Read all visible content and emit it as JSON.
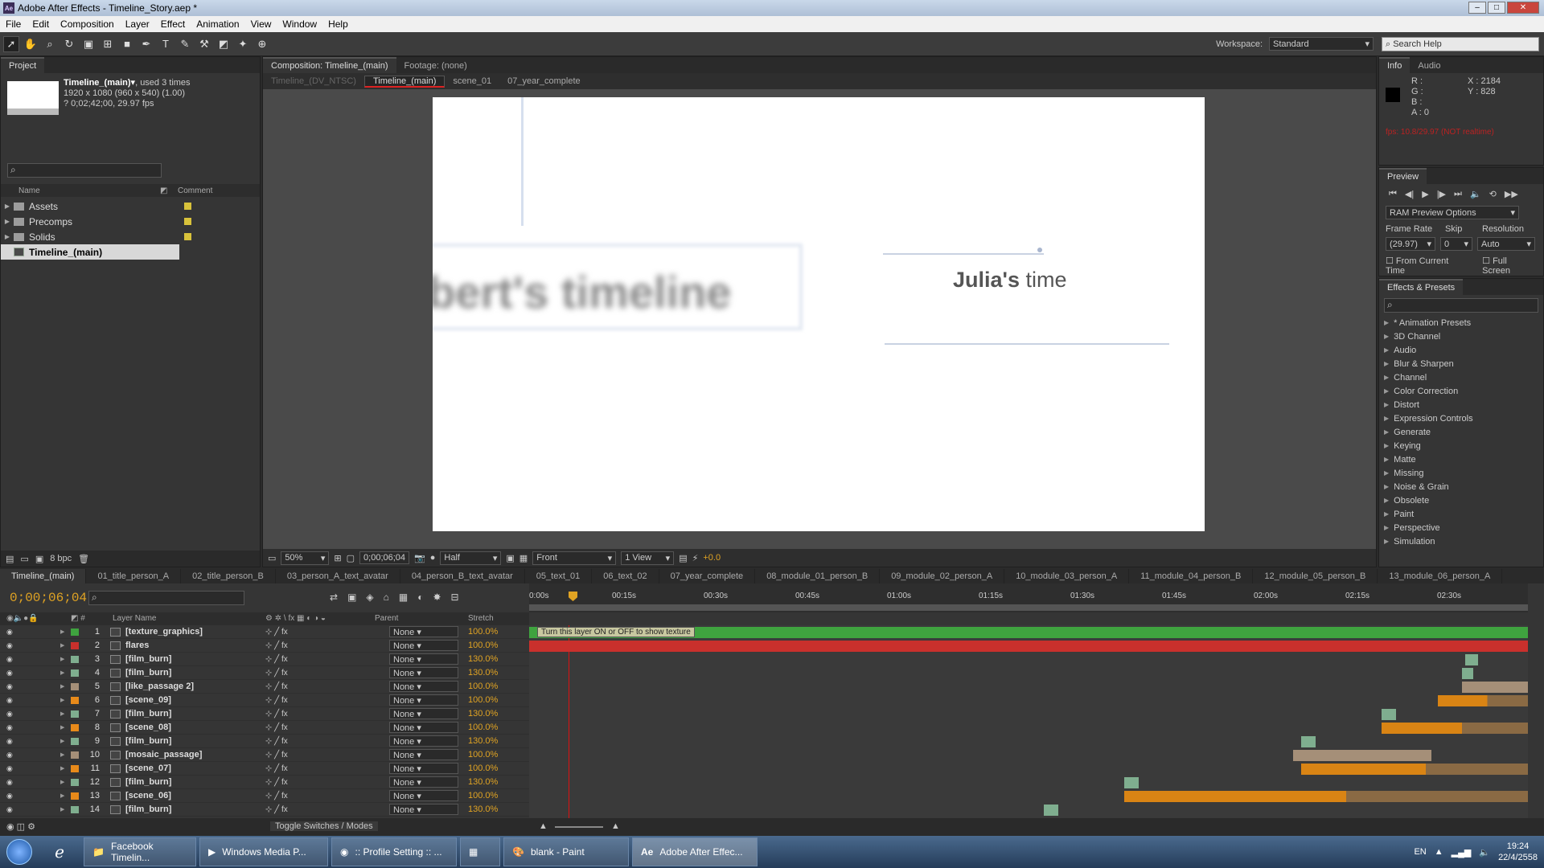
{
  "window": {
    "title": "Adobe After Effects - Timeline_Story.aep *"
  },
  "menu": [
    "File",
    "Edit",
    "Composition",
    "Layer",
    "Effect",
    "Animation",
    "View",
    "Window",
    "Help"
  ],
  "toolbar": {
    "workspace_label": "Workspace:",
    "workspace_value": "Standard",
    "search_placeholder": "Search Help"
  },
  "project": {
    "tab": "Project",
    "item_name": "Timeline_(main)▾",
    "item_used": ", used 3 times",
    "item_size": "1920 x 1080  (960 x 540) (1.00)",
    "item_duration": "? 0;02;42;00, 29.97 fps",
    "col_name": "Name",
    "col_comment": "Comment",
    "items": [
      {
        "name": "Assets",
        "type": "folder"
      },
      {
        "name": "Precomps",
        "type": "folder"
      },
      {
        "name": "Solids",
        "type": "folder"
      },
      {
        "name": "Timeline_(main)",
        "type": "comp"
      }
    ],
    "bpc": "8 bpc"
  },
  "comp": {
    "tab": "Composition: Timeline_(main)",
    "footage_tab": "Footage: (none)",
    "crumbs": [
      "Timeline_(DV_NTSC)",
      "Timeline_(main)",
      "scene_01",
      "07_year_complete"
    ],
    "canvas_text_left": "bert's timeline",
    "canvas_text_right_bold": "Julia's",
    "canvas_text_right": " time",
    "zoom": "50%",
    "timecode": "0;00;06;04",
    "resolution": "Half",
    "view": "Front",
    "views": "1 View",
    "exposure": "+0.0"
  },
  "info": {
    "tab": "Info",
    "tab2": "Audio",
    "r": "R :",
    "g": "G :",
    "b": "B :",
    "a": "A : 0",
    "x": "X : 2184",
    "y": "Y : 828",
    "warning": "fps: 10.8/29.97 (NOT realtime)"
  },
  "preview": {
    "tab": "Preview",
    "ram": "RAM Preview Options",
    "frame_rate_label": "Frame Rate",
    "skip_label": "Skip",
    "resolution_label": "Resolution",
    "frame_rate": "(29.97)",
    "skip": "0",
    "resolution": "Auto",
    "from_current": "From Current Time",
    "full_screen": "Full Screen"
  },
  "effects": {
    "tab": "Effects & Presets",
    "items": [
      "* Animation Presets",
      "3D Channel",
      "Audio",
      "Blur & Sharpen",
      "Channel",
      "Color Correction",
      "Distort",
      "Expression Controls",
      "Generate",
      "Keying",
      "Matte",
      "Missing",
      "Noise & Grain",
      "Obsolete",
      "Paint",
      "Perspective",
      "Simulation"
    ]
  },
  "timeline": {
    "tabs": [
      "Timeline_(main)",
      "01_title_person_A",
      "02_title_person_B",
      "03_person_A_text_avatar",
      "04_person_B_text_avatar",
      "05_text_01",
      "06_text_02",
      "07_year_complete",
      "08_module_01_person_B",
      "09_module_02_person_A",
      "10_module_03_person_A",
      "11_module_04_person_B",
      "12_module_05_person_B",
      "13_module_06_person_A"
    ],
    "timecode": "0;00;06;04",
    "col_layer": "Layer Name",
    "col_parent": "Parent",
    "col_stretch": "Stretch",
    "ticks": [
      "0:00s",
      "00:15s",
      "00:30s",
      "00:45s",
      "01:00s",
      "01:15s",
      "01:30s",
      "01:45s",
      "02:00s",
      "02:15s",
      "02:30s"
    ],
    "tooltip": "Turn this layer ON or OFF to show texture",
    "footer": "Toggle Switches / Modes",
    "layers": [
      {
        "num": "1",
        "name": "[texture_graphics]",
        "label": "#3fa33f",
        "parent": "None",
        "stretch": "100.0%"
      },
      {
        "num": "2",
        "name": "flares",
        "label": "#c9302c",
        "parent": "None",
        "stretch": "100.0%"
      },
      {
        "num": "3",
        "name": "[film_burn]",
        "label": "#7fae8f",
        "parent": "None",
        "stretch": "130.0%"
      },
      {
        "num": "4",
        "name": "[film_burn]",
        "label": "#7fae8f",
        "parent": "None",
        "stretch": "130.0%"
      },
      {
        "num": "5",
        "name": "[like_passage 2]",
        "label": "#a58f78",
        "parent": "None",
        "stretch": "100.0%"
      },
      {
        "num": "6",
        "name": "[scene_09]",
        "label": "#e88a1a",
        "parent": "None",
        "stretch": "100.0%"
      },
      {
        "num": "7",
        "name": "[film_burn]",
        "label": "#7fae8f",
        "parent": "None",
        "stretch": "130.0%"
      },
      {
        "num": "8",
        "name": "[scene_08]",
        "label": "#e88a1a",
        "parent": "None",
        "stretch": "100.0%"
      },
      {
        "num": "9",
        "name": "[film_burn]",
        "label": "#7fae8f",
        "parent": "None",
        "stretch": "130.0%"
      },
      {
        "num": "10",
        "name": "[mosaic_passage]",
        "label": "#a58f78",
        "parent": "None",
        "stretch": "100.0%"
      },
      {
        "num": "11",
        "name": "[scene_07]",
        "label": "#e88a1a",
        "parent": "None",
        "stretch": "100.0%"
      },
      {
        "num": "12",
        "name": "[film_burn]",
        "label": "#7fae8f",
        "parent": "None",
        "stretch": "130.0%"
      },
      {
        "num": "13",
        "name": "[scene_06]",
        "label": "#e88a1a",
        "parent": "None",
        "stretch": "100.0%"
      },
      {
        "num": "14",
        "name": "[film_burn]",
        "label": "#7fae8f",
        "parent": "None",
        "stretch": "130.0%"
      }
    ]
  },
  "taskbar": {
    "items": [
      "Facebook Timelin...",
      "Windows Media P...",
      ":: Profile Setting :: ...",
      "blank - Paint",
      "Adobe After Effec..."
    ],
    "lang": "EN",
    "time": "19:24",
    "date": "22/4/2558"
  }
}
